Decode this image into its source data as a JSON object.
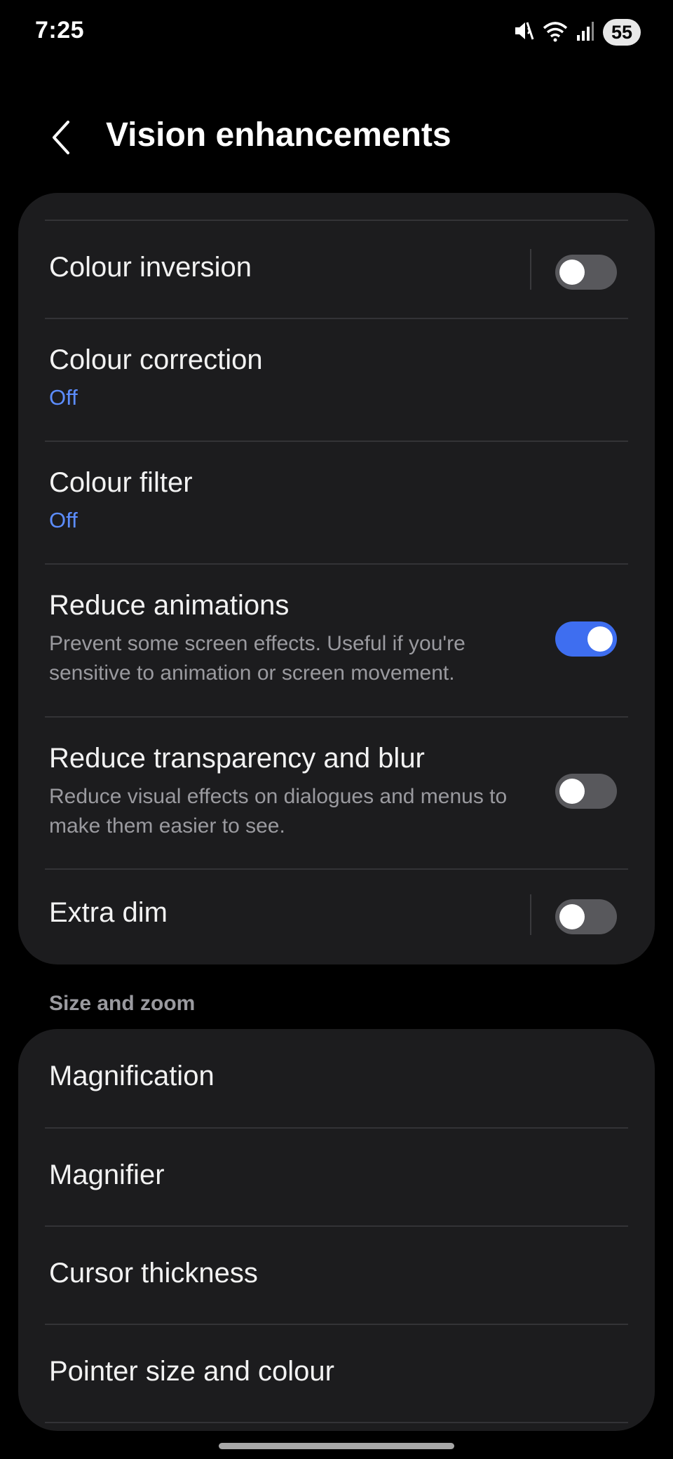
{
  "status_bar": {
    "time": "7:25",
    "battery": "55",
    "icons": [
      "mute-icon",
      "wifi-icon",
      "signal-icon"
    ]
  },
  "header": {
    "title": "Vision enhancements",
    "back_icon": "chevron-left-icon"
  },
  "settings": [
    {
      "title": "Colour inversion",
      "toggle": false
    },
    {
      "title": "Colour correction",
      "status": "Off"
    },
    {
      "title": "Colour filter",
      "status": "Off"
    },
    {
      "title": "Reduce animations",
      "description": "Prevent some screen effects. Useful if you're sensitive to animation or screen movement.",
      "toggle": true
    },
    {
      "title": "Reduce transparency and blur",
      "description": "Reduce visual effects on dialogues and menus to make them easier to see.",
      "toggle": false
    },
    {
      "title": "Extra dim",
      "toggle": false
    }
  ],
  "size_zoom": {
    "header": "Size and zoom",
    "items": [
      {
        "title": "Magnification"
      },
      {
        "title": "Magnifier"
      },
      {
        "title": "Cursor thickness"
      },
      {
        "title": "Pointer size and colour"
      }
    ]
  },
  "colors": {
    "background": "#000000",
    "card": "#1c1c1e",
    "accent_blue": "#5c8dff",
    "toggle_on": "#3e6ef0",
    "toggle_off": "#58585c"
  }
}
